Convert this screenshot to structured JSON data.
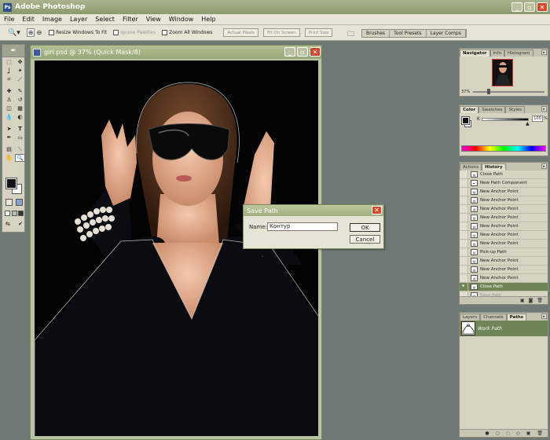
{
  "app": {
    "title": "Adobe Photoshop"
  },
  "menu": [
    "File",
    "Edit",
    "Image",
    "Layer",
    "Select",
    "Filter",
    "View",
    "Window",
    "Help"
  ],
  "options": {
    "resize_windows": "Resize Windows To Fit",
    "ignore_palettes": "Ignore Palettes",
    "zoom_all": "Zoom All Windows",
    "actual_pixels": "Actual Pixels",
    "fit_on_screen": "Fit On Screen",
    "print_size": "Print Size"
  },
  "palette_well": [
    "Brushes",
    "Tool Presets",
    "Layer Comps"
  ],
  "document": {
    "title": "girl.psd @ 37% (Quick Mask/8)"
  },
  "dialog": {
    "title": "Save Path",
    "name_label": "Name:",
    "name_value": "Контур",
    "ok": "OK",
    "cancel": "Cancel"
  },
  "navigator": {
    "tabs": [
      "Navigator",
      "Info",
      "Histogram"
    ],
    "zoom": "37%"
  },
  "color": {
    "tabs": [
      "Color",
      "Swatches",
      "Styles"
    ],
    "k_label": "K",
    "k_value": "100",
    "k_unit": "%"
  },
  "history": {
    "tabs": [
      "Actions",
      "History"
    ],
    "items": [
      "Close Path",
      "New Path Component",
      "New Anchor Point",
      "New Anchor Point",
      "New Anchor Point",
      "New Anchor Point",
      "New Anchor Point",
      "New Anchor Point",
      "New Anchor Point",
      "Pick-up Path",
      "New Anchor Point",
      "New Anchor Point",
      "New Anchor Point",
      "Close Path",
      "Save Path"
    ]
  },
  "layers": {
    "tabs": [
      "Layers",
      "Channels",
      "Paths"
    ],
    "work_path": "Work Path"
  },
  "colors": {
    "title_bar": "#95a472",
    "selection": "#6f8457",
    "background": "#6f7a76"
  }
}
